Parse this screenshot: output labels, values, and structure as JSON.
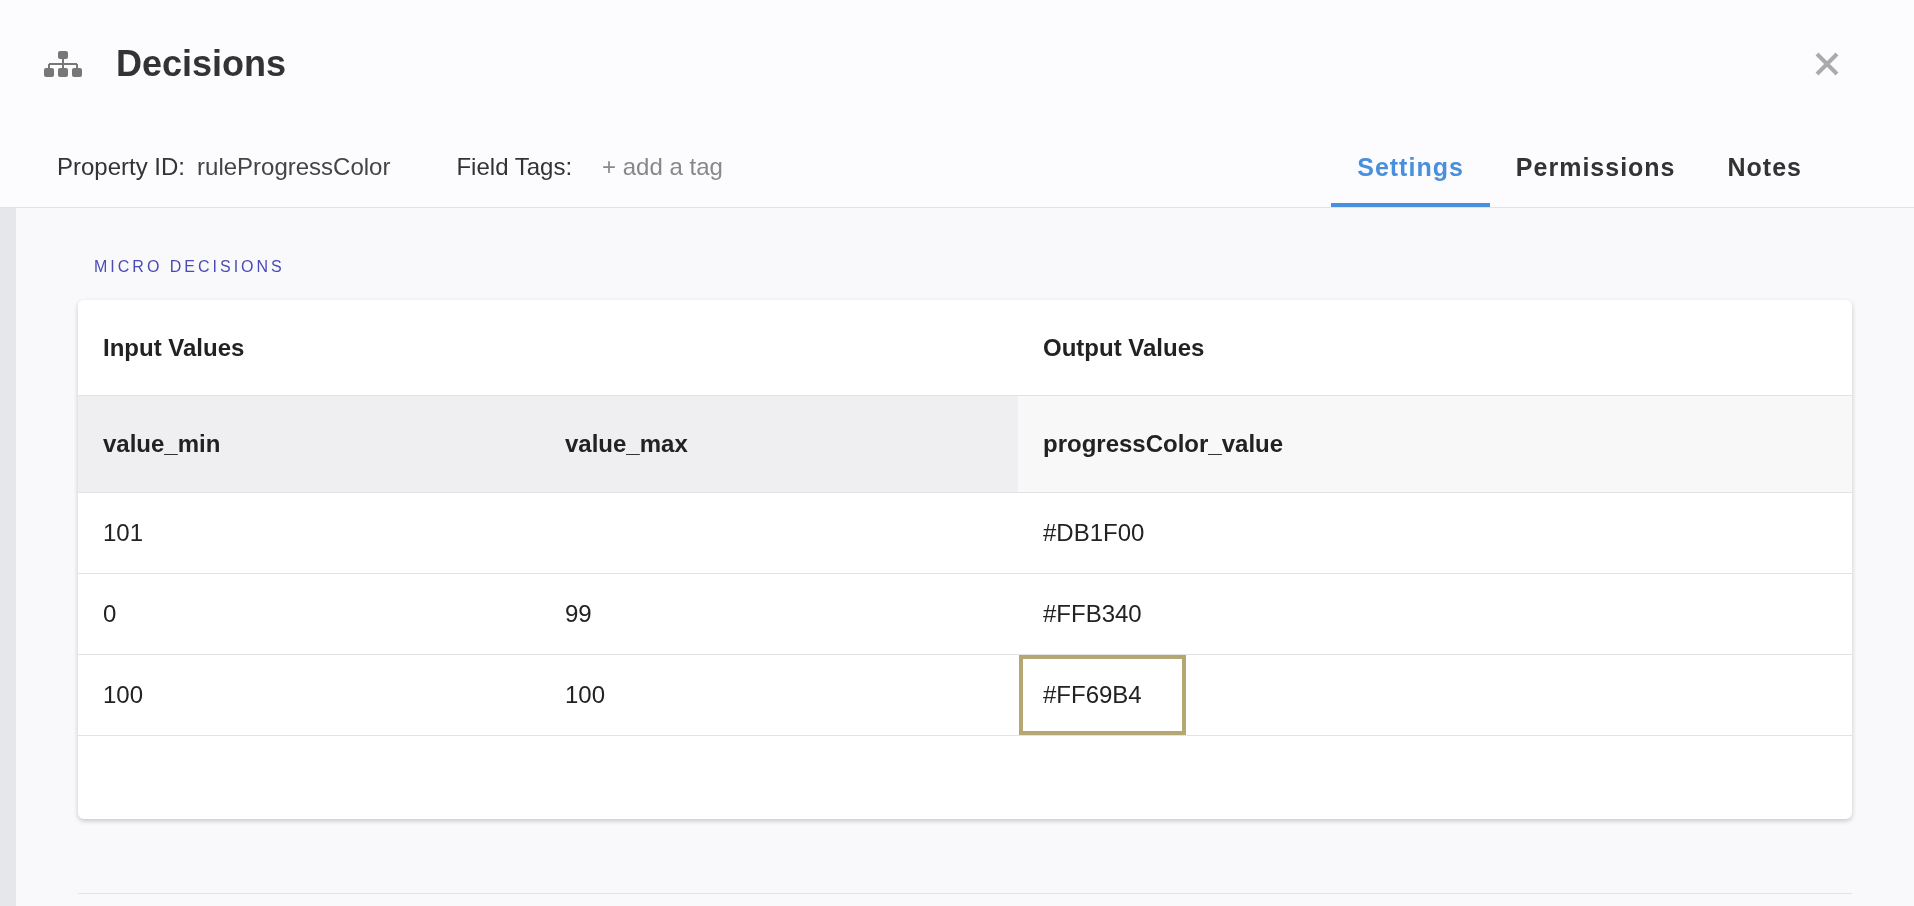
{
  "header": {
    "title": "Decisions",
    "property_id_label": "Property ID:",
    "property_id": "ruleProgressColor",
    "field_tags_label": "Field Tags:",
    "add_tag": "+ add a tag"
  },
  "tabs": [
    {
      "label": "Settings",
      "selected": true
    },
    {
      "label": "Permissions",
      "selected": false
    },
    {
      "label": "Notes",
      "selected": false
    }
  ],
  "section_title": "MICRO DECISIONS",
  "table": {
    "input_heading": "Input Values",
    "output_heading": "Output Values",
    "columns": [
      "value_min",
      "value_max",
      "progressColor_value"
    ],
    "rows": [
      {
        "value_min": "101",
        "progressColor_value": "#DB1F00",
        "highlighted": false
      },
      {
        "value_min": "0",
        "value_max": "99",
        "progressColor_value": "#FFB340",
        "highlighted": false
      },
      {
        "value_min": "100",
        "value_max": "100",
        "progressColor_value": "#FF69B4",
        "highlighted": true
      }
    ]
  }
}
